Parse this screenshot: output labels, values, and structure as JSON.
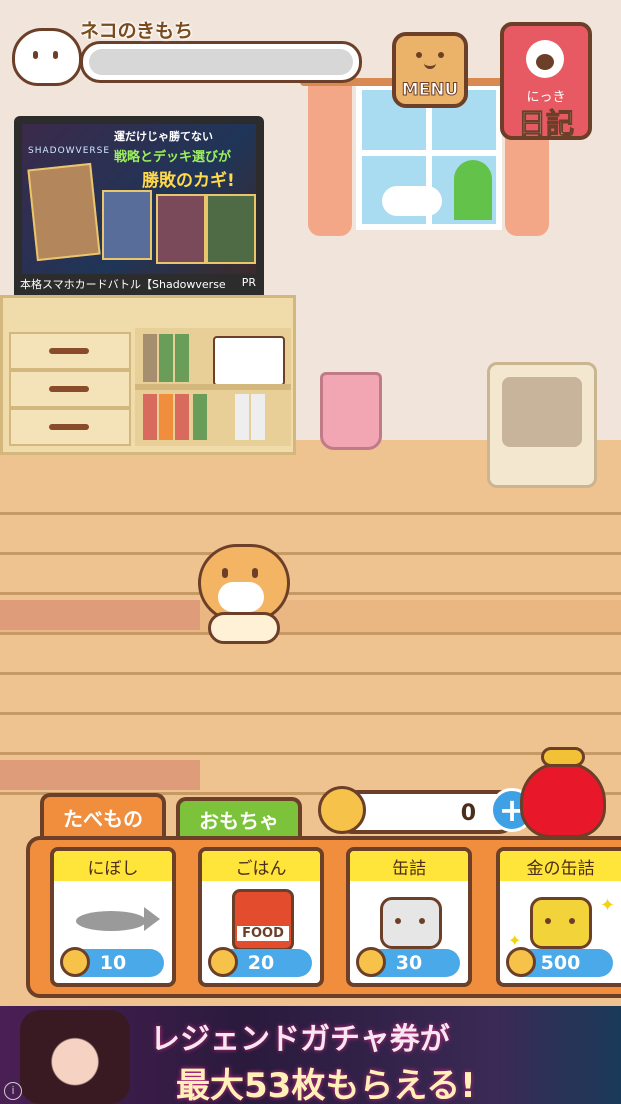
{
  "header": {
    "mood_label": "ネコのきもち",
    "menu_label": "MENU",
    "diary_furigana": "にっき",
    "diary_label": "日記"
  },
  "tv_ad": {
    "headline_1": "運だけじゃ勝てない",
    "headline_2": "戦略とデッキ選びが",
    "headline_3": "勝敗のカギ!",
    "logo": "SHADOWVERSE",
    "caption": "本格スマホカードバトル【Shadowverse",
    "pr": "PR"
  },
  "tabs": [
    {
      "label": "たべもの",
      "active": true
    },
    {
      "label": "おもちゃ",
      "active": false
    }
  ],
  "coins": {
    "value": "0",
    "add_label": "+"
  },
  "items": [
    {
      "name": "にぼし",
      "price": "10",
      "icon": "fish-icon"
    },
    {
      "name": "ごはん",
      "price": "20",
      "icon": "food-bag-icon",
      "icon_text": "FOOD"
    },
    {
      "name": "缶詰",
      "price": "30",
      "icon": "can-icon"
    },
    {
      "name": "金の缶詰",
      "price": "500",
      "icon": "gold-can-icon"
    }
  ],
  "bottom_ad": {
    "line1": "レジェンドガチャ券が",
    "line2": "最大53枚もらえる!"
  },
  "colors": {
    "accent_orange": "#f08e3e",
    "tab_food": "#f08e3e",
    "tab_toys": "#7cc23a",
    "price_blue": "#4aa9e8",
    "outline_brown": "#6b3f28"
  }
}
